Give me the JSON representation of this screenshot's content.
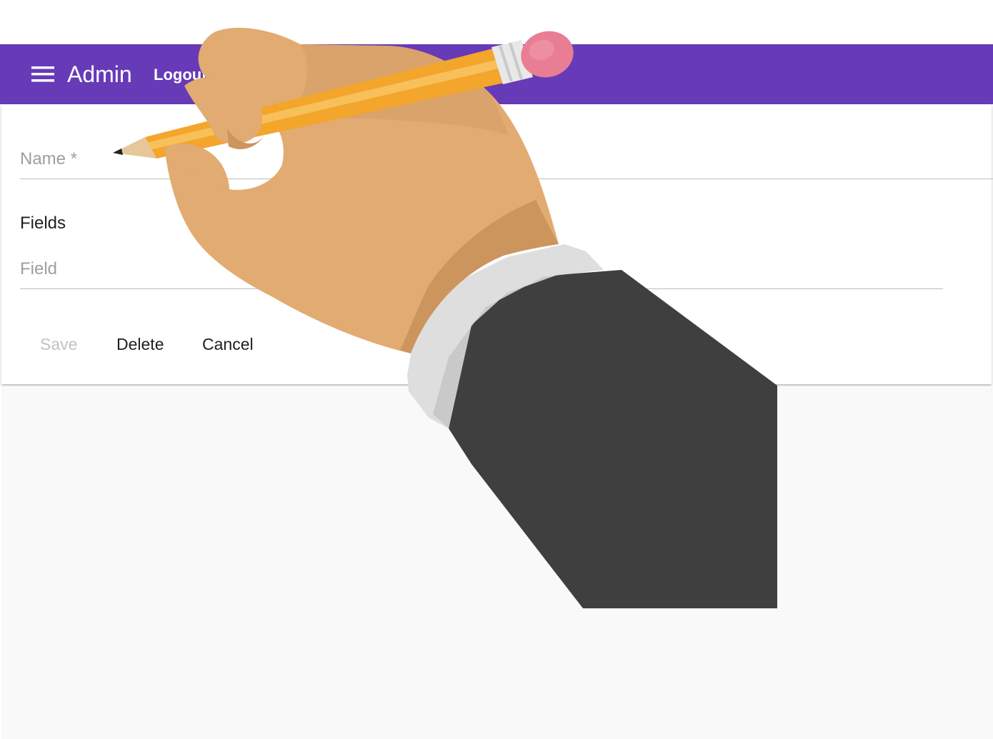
{
  "appbar": {
    "title": "Admin",
    "logout_label": "Logout",
    "menu_icon": "menu-icon",
    "color": "#673ab7"
  },
  "form": {
    "name_placeholder": "Name *",
    "fields_heading": "Fields",
    "field_placeholder": "Field",
    "actions": {
      "save_label": "Save",
      "delete_label": "Delete",
      "cancel_label": "Cancel"
    }
  },
  "overlay": {
    "icon": "hand-writing-with-pencil-illustration"
  }
}
